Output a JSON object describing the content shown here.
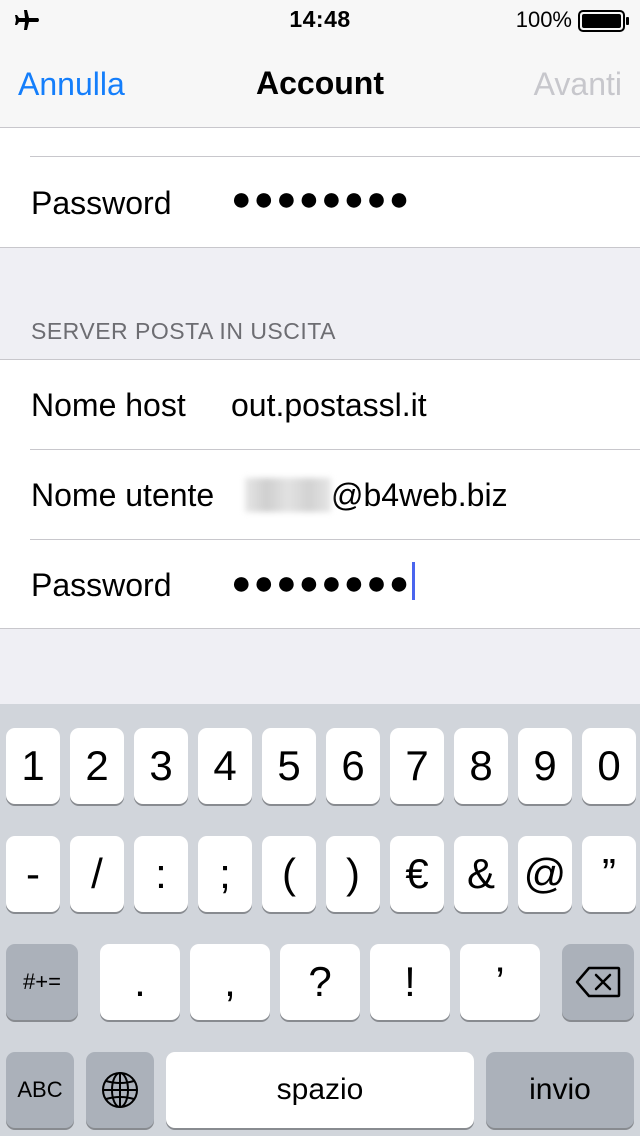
{
  "status_bar": {
    "time": "14:48",
    "battery_percent": "100%",
    "icons": [
      "airplane-icon",
      "battery-icon"
    ]
  },
  "nav": {
    "cancel_label": "Annulla",
    "title": "Account",
    "next_label": "Avanti"
  },
  "incoming": {
    "password_label": "Password",
    "password_value": "●●●●●●●●"
  },
  "outgoing": {
    "section_title": "SERVER POSTA IN USCITA",
    "host_label": "Nome host",
    "host_value": "out.postassl.it",
    "user_label": "Nome utente",
    "user_domain": "@b4web.biz",
    "password_label": "Password",
    "password_value": "●●●●●●●●"
  },
  "keyboard": {
    "row1": [
      "1",
      "2",
      "3",
      "4",
      "5",
      "6",
      "7",
      "8",
      "9",
      "0"
    ],
    "row2": [
      "-",
      "/",
      ":",
      ";",
      "(",
      ")",
      "€",
      "&",
      "@",
      "”"
    ],
    "row3": [
      ".",
      ",",
      "?",
      "!",
      "’"
    ],
    "symbols_key": "#+=",
    "abc_key": "ABC",
    "space_key": "spazio",
    "return_key": "invio",
    "icons": [
      "globe-icon",
      "backspace-icon"
    ]
  },
  "colors": {
    "accent": "#147efb",
    "disabled": "#c7c7cc",
    "caret": "#4a65ee"
  }
}
